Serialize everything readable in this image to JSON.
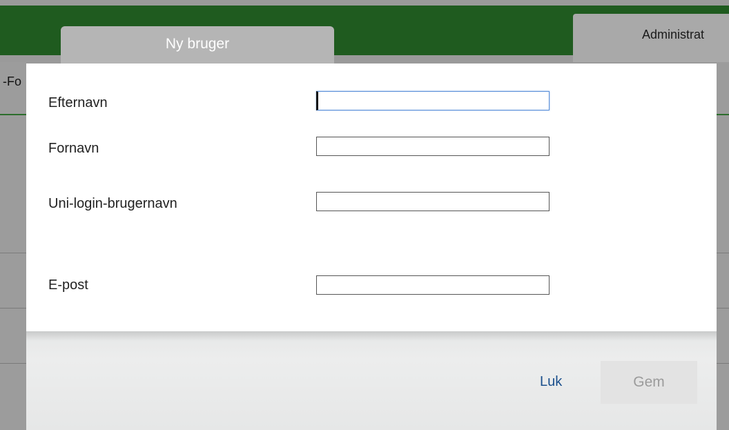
{
  "background": {
    "admin_tab_label": "Administrat",
    "left_fragment": "-Fo"
  },
  "dialog": {
    "tab_title": "Ny bruger",
    "fields": [
      {
        "label": "Efternavn",
        "value": ""
      },
      {
        "label": "Fornavn",
        "value": ""
      },
      {
        "label": "Uni-login-brugernavn",
        "value": ""
      },
      {
        "label": "E-post",
        "value": ""
      }
    ],
    "close_label": "Luk",
    "save_label": "Gem"
  },
  "colors": {
    "header_green": "#1f5b1f",
    "link_blue": "#1b4f8c",
    "focus_blue": "#5a8fd8"
  }
}
